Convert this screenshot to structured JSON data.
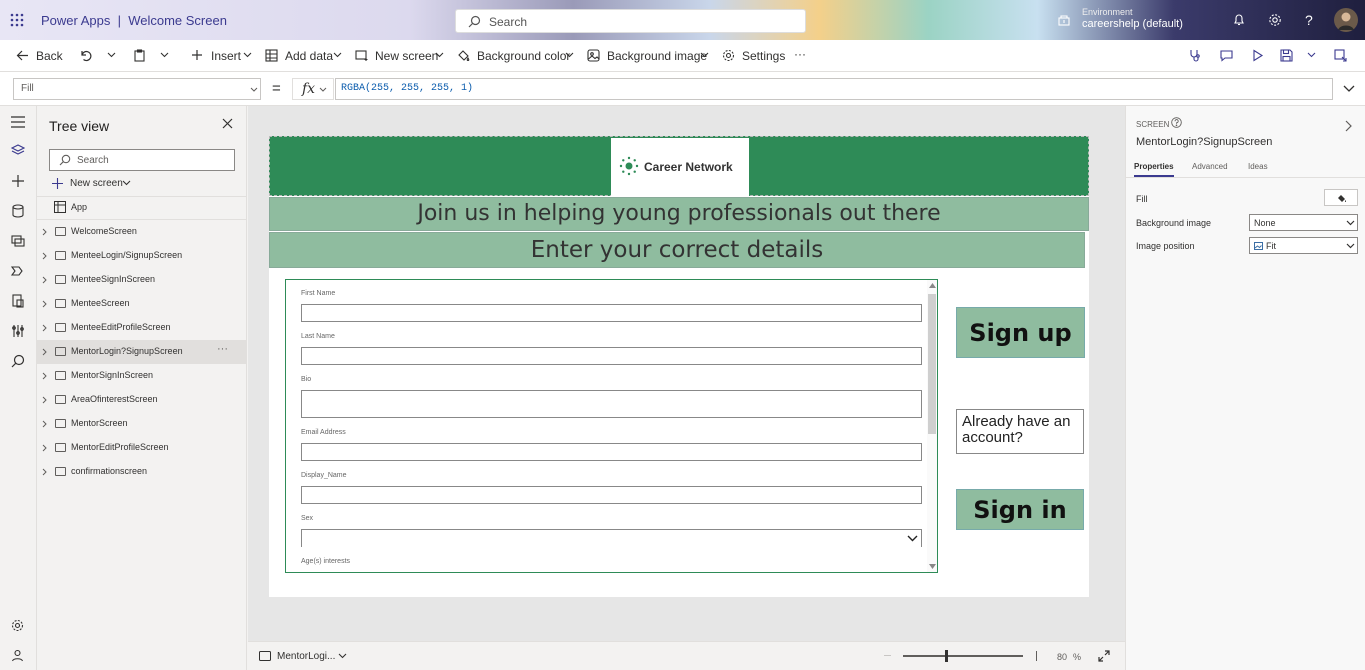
{
  "header": {
    "app_title": "Power Apps  |  Welcome Screen",
    "search_placeholder": "Search",
    "environment_label": "Environment",
    "environment_value": "careershelp (default)"
  },
  "commandbar": {
    "back": "Back",
    "insert": "Insert",
    "add_data": "Add data",
    "new_screen": "New screen",
    "background_color": "Background color",
    "background_image": "Background image",
    "settings": "Settings",
    "more": "···"
  },
  "formulabar": {
    "property": "Fill",
    "equals": "=",
    "fx": "fx",
    "formula": "RGBA(255, 255, 255, 1)"
  },
  "tree": {
    "title": "Tree view",
    "search_placeholder": "Search",
    "new_screen": "New screen",
    "app_item": "App",
    "screens": [
      "WelcomeScreen",
      "MenteeLogin/SignupScreen",
      "MenteeSignInScreen",
      "MenteeScreen",
      "MenteeEditProfileScreen",
      "MentorLogin?SignupScreen",
      "MentorSignInScreen",
      "AreaOfinterestScreen",
      "MentorScreen",
      "MentorEditProfileScreen",
      "confirmationscreen"
    ],
    "selected_index": 5,
    "row_more": "···"
  },
  "canvas": {
    "logo_text": "Career Network",
    "heading": "Join us in helping young professionals out there",
    "subheading": "Enter your correct details",
    "form": {
      "fields": [
        "First Name",
        "Last Name",
        "Bio",
        "Email Address",
        "Display_Name",
        "Sex",
        "Age(s) interests"
      ]
    },
    "signup_label": "Sign up",
    "already_label": "Already have an account?",
    "signin_label": "Sign in",
    "colors": {
      "banner": "#2e8b57",
      "strip": "#8fbc9f"
    }
  },
  "bottombar": {
    "screen_name": "MentorLogi...",
    "zoom_value": "80",
    "zoom_unit": "%",
    "zoom_level": 0.8
  },
  "rightpanel": {
    "section": "SCREEN",
    "screen_name": "MentorLogin?SignupScreen",
    "tabs": [
      "Properties",
      "Advanced",
      "Ideas"
    ],
    "active_tab": "Properties",
    "fill_label": "Fill",
    "background_image_label": "Background image",
    "background_image_value": "None",
    "image_position_label": "Image position",
    "image_position_value": "Fit"
  }
}
